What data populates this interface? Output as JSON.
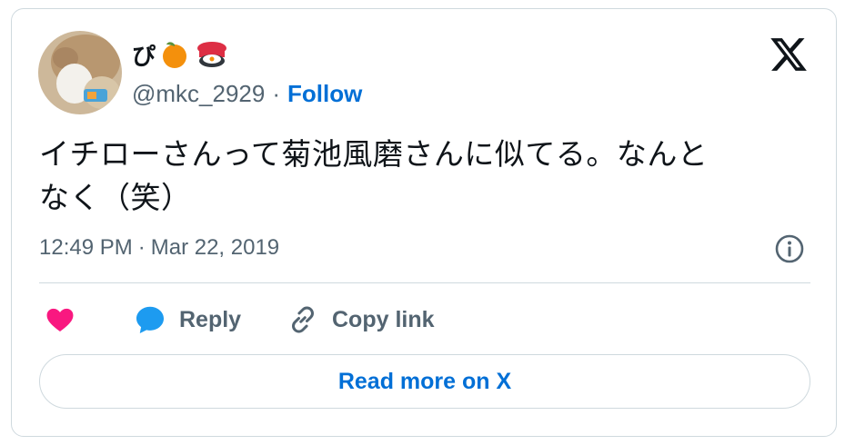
{
  "author": {
    "display_name": "ぴ",
    "emojis": [
      "orange-emoji",
      "sushi-emoji"
    ],
    "handle": "@mkc_2929",
    "separator": "·",
    "follow_label": "Follow"
  },
  "tweet": {
    "text_line1": "イチローさんって菊池風磨さんに似てる。なんと",
    "text_line2": "なく（笑）",
    "time": "12:49 PM",
    "meta_separator": "·",
    "date": "Mar 22, 2019"
  },
  "actions": {
    "like_label": "",
    "reply_label": "Reply",
    "copy_link_label": "Copy link"
  },
  "footer": {
    "read_more_label": "Read more on X"
  },
  "icons": {
    "platform_logo": "x-logo-icon",
    "info": "info-icon",
    "like": "heart-icon",
    "reply": "reply-bubble-icon",
    "copy": "link-icon"
  },
  "colors": {
    "accent": "#006fd6",
    "like": "#f91880",
    "reply": "#1d9bf0",
    "muted": "#536471",
    "border": "#cfd9de",
    "text": "#0f1419"
  }
}
